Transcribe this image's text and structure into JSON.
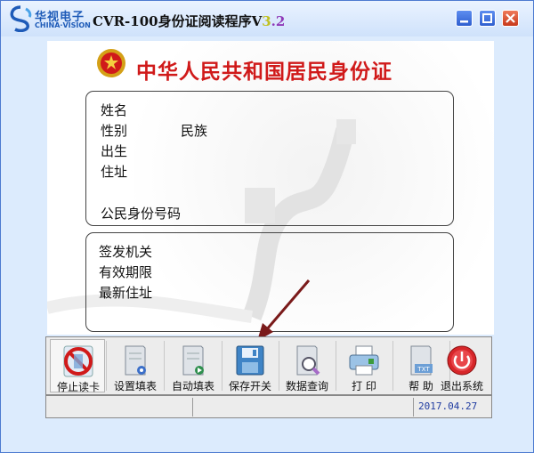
{
  "window": {
    "title_main": "CVR-100身份证阅读程序V",
    "title_v1": "3",
    "title_v2": ".2",
    "logo_cn": "华视电子",
    "logo_en": "CHINA·VISION",
    "controls": [
      "minimize-icon",
      "maximize-icon",
      "close-icon"
    ]
  },
  "card": {
    "title": "中华人民共和国居民身份证",
    "fields": {
      "name": "姓名",
      "gender": "性别",
      "ethnicity": "民族",
      "birth": "出生",
      "address": "住址",
      "id_number": "公民身份号码",
      "issuer": "签发机关",
      "validity": "有效期限",
      "latest_address": "最新住址"
    }
  },
  "toolbar": {
    "buttons": [
      {
        "label": "停止读卡",
        "icon": "stop-icon"
      },
      {
        "label": "设置填表",
        "icon": "form-settings-icon"
      },
      {
        "label": "自动填表",
        "icon": "auto-fill-icon"
      },
      {
        "label": "保存开关",
        "icon": "floppy-save-icon"
      },
      {
        "label": "数据查询",
        "icon": "search-doc-icon"
      },
      {
        "label": "打 印",
        "icon": "printer-icon"
      },
      {
        "label": "帮 助",
        "icon": "help-doc-icon"
      },
      {
        "label": "退出系统",
        "icon": "power-icon"
      }
    ]
  },
  "status": {
    "date": "2017.04.27"
  },
  "colors": {
    "title_red": "#d01a1a",
    "frame_blue": "#dcebfd",
    "date_blue": "#1f3ba0"
  }
}
